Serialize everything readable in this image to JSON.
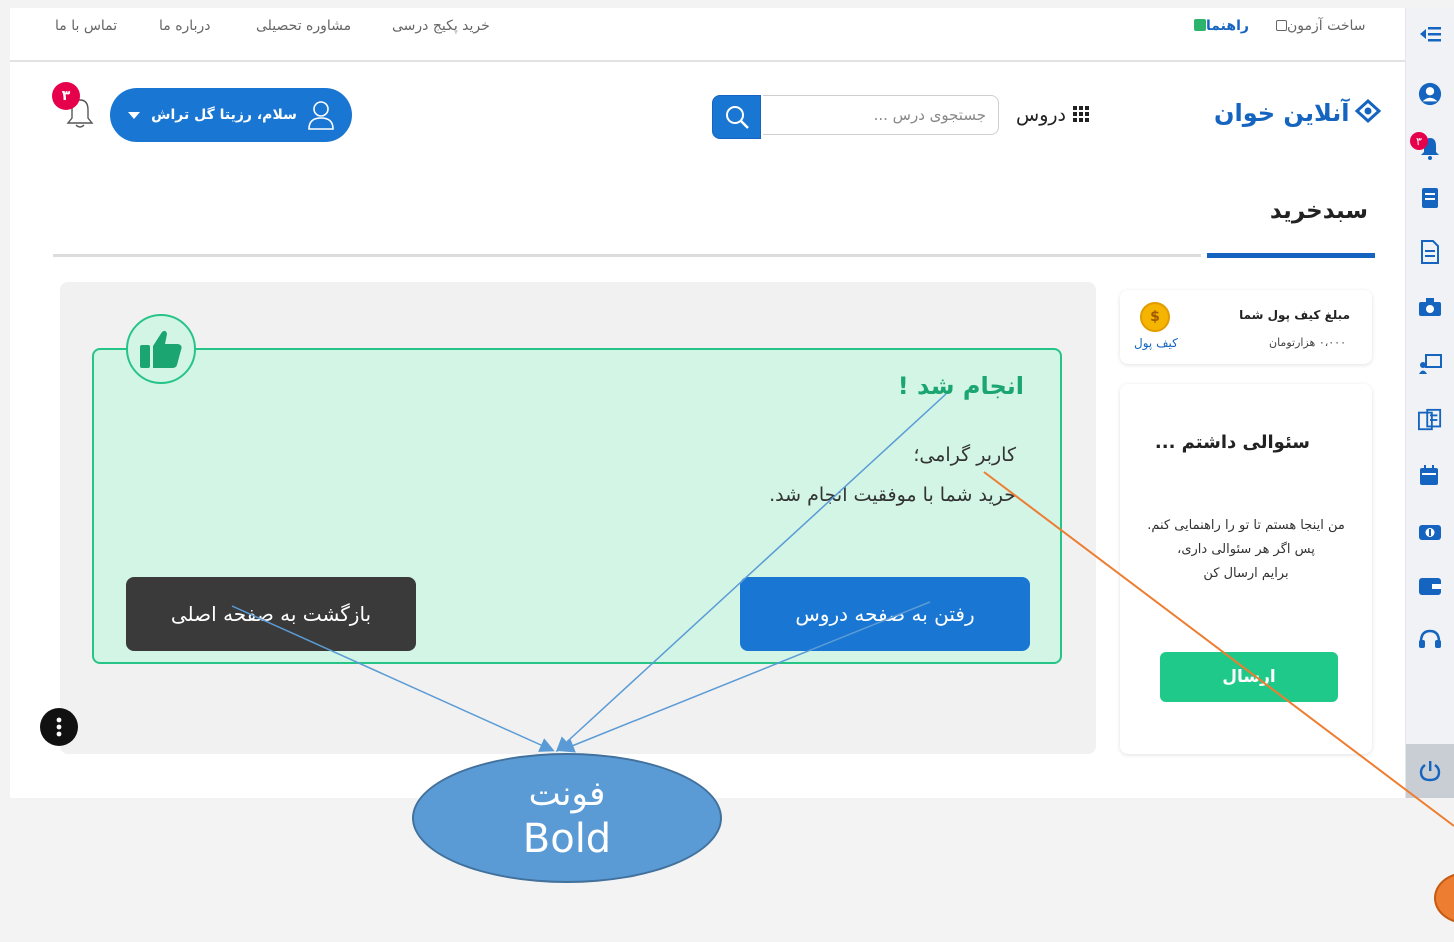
{
  "top_links": {
    "quiz_builder": "ساخت آزمون",
    "guide": "راهنما",
    "buy_package": "خرید پکیج درسی",
    "consulting": "مشاوره تحصیلی",
    "about": "درباره ما",
    "contact": "تماس با ما"
  },
  "header": {
    "logo": "آنلاین خوان",
    "courses_menu": "دروس",
    "search_placeholder": "جستجوی درس ...",
    "user_greeting": "سلام، رزیتا گل تراش",
    "notification_count": "۳"
  },
  "sidebar": {
    "notification_count": "۳",
    "icons": [
      "menu-collapse-icon",
      "user-icon",
      "bell-icon",
      "book-icon",
      "document-icon",
      "exam-icon",
      "classroom-icon",
      "package-icon",
      "calendar-icon",
      "money-icon",
      "wallet-icon",
      "support-icon",
      "power-icon"
    ]
  },
  "page": {
    "title": "سبدخرید"
  },
  "success": {
    "title": "انجام شد !",
    "dear_user": "کاربر گرامی؛",
    "message": "خرید شما با موفقیت انجام شد.",
    "go_courses_button": "رفتن به صفحه دروس",
    "go_home_button": "بازگشت به صفحه اصلی"
  },
  "wallet": {
    "label": "مبلغ کیف پول شما",
    "value": "۰،۰۰۰ هزارتومان",
    "link": "کیف پول",
    "coin_symbol": "$"
  },
  "question": {
    "title": "سئوالی داشتم ...",
    "line1": "من اینجا هستم تا تو را راهنمایی کنم.",
    "line2": "پس اگر هر سئوالی داری،",
    "line3": "برایم ارسال کن",
    "send_button": "ارسال"
  },
  "annotation": {
    "label_line1": "فونت",
    "label_line2": "Bold"
  },
  "colors": {
    "primary_blue": "#1976d2",
    "success_green": "#1fc98a",
    "success_bg": "#d2f5e6",
    "badge_red": "#e6004c",
    "annotation_blue": "#5b9bd5",
    "annotation_orange": "#ed7d31"
  }
}
